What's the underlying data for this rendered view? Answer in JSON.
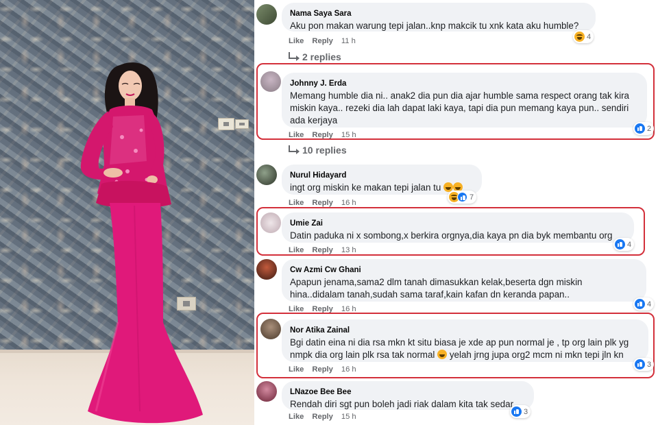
{
  "colors": {
    "like_blue": "#1877f2",
    "highlight_red": "#d32f3a",
    "dress_pink": "#e0197a",
    "bubble_bg": "#f0f2f5"
  },
  "photo": {
    "subject": "woman in pink lace kebaya gown",
    "icon": "photo-image"
  },
  "labels": {
    "like": "Like",
    "reply": "Reply"
  },
  "comments": [
    {
      "author": "Nama Saya Sara",
      "text": "Aku pon makan warung tepi jalan..knp makcik tu xnk kata aku humble?",
      "time": "11 h",
      "reaction_count": "4",
      "reaction_icons": [
        "haha-icon"
      ],
      "replies": "2 replies"
    },
    {
      "author": "Johnny J. Erda",
      "text": "Memang humble dia ni.. anak2 dia pun dia ajar humble sama respect orang tak kira miskin kaya.. rezeki dia lah dapat laki kaya, tapi dia pun memang kaya pun.. sendiri ada kerjaya",
      "time": "15 h",
      "reaction_count": "2",
      "reaction_icons": [
        "like-icon"
      ],
      "replies": "10 replies"
    },
    {
      "author": "Nurul Hidayard",
      "text": "ingt org miskin ke makan tepi jalan tu",
      "time": "16 h",
      "reaction_count": "7",
      "reaction_icons": [
        "haha-icon",
        "like-icon"
      ]
    },
    {
      "author": "Umie Zai",
      "text": "Datin paduka ni x sombong,x berkira orgnya,dia kaya pn dia byk membantu org",
      "time": "13 h",
      "reaction_count": "4",
      "reaction_icons": [
        "like-icon"
      ]
    },
    {
      "author": "Cw Azmi Cw Ghani",
      "text": "Apapun jenama,sama2 dlm tanah dimasukkan kelak,beserta dgn miskin hina..didalam tanah,sudah sama taraf,kain kafan dn keranda papan..",
      "time": "16 h",
      "reaction_count": "4",
      "reaction_icons": [
        "like-icon"
      ]
    },
    {
      "author": "Nor Atika Zainal",
      "text": "Bgi datin eina ni dia rsa mkn kt situ biasa je xde ap pun normal je , tp org lain plk yg nmpk dia org lain plk rsa tak normal",
      "text_tail": "yelah jrng jupa org2 mcm ni mkn tepi jln kn",
      "time": "16 h",
      "reaction_count": "3",
      "reaction_icons": [
        "like-icon"
      ]
    },
    {
      "author": "LNazoe Bee Bee",
      "text": "Rendah diri sgt pun boleh jadi riak dalam kita tak sedar..",
      "time": "15 h",
      "reaction_count": "3",
      "reaction_icons": [
        "like-icon"
      ]
    }
  ]
}
